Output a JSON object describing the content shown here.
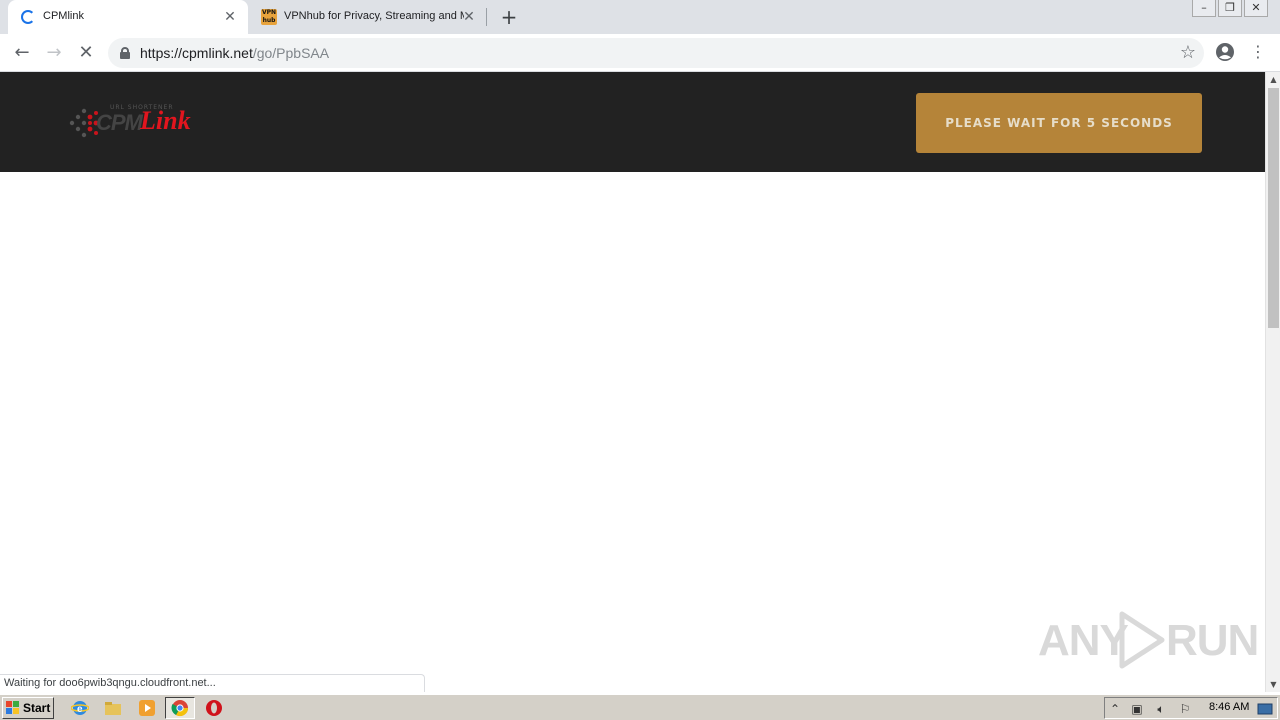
{
  "browser": {
    "tabs": [
      {
        "title": "CPMlink",
        "favicon": "loading-spinner-icon",
        "active": true
      },
      {
        "title": "VPNhub for Privacy, Streaming and M",
        "favicon": "vpnhub-icon",
        "favicon_text": "VPN hub",
        "active": false
      }
    ],
    "address": {
      "host": "https://cpmlink.net",
      "path": "/go/PpbSAA"
    },
    "status_text": "Waiting for doo6pwib3qngu.cloudfront.net..."
  },
  "page": {
    "logo": {
      "mark": "CPM",
      "word": "Link",
      "tagline": "URL SHORTENER"
    },
    "wait_button": "PLEASE WAIT FOR 5 SECONDS"
  },
  "watermark": {
    "left": "ANY",
    "right": "RUN"
  },
  "taskbar": {
    "start_label": "Start",
    "clock": "8:46 AM"
  },
  "colors": {
    "header_bg": "#222222",
    "button_bg": "#b58439",
    "logo_red": "#e2151e"
  }
}
